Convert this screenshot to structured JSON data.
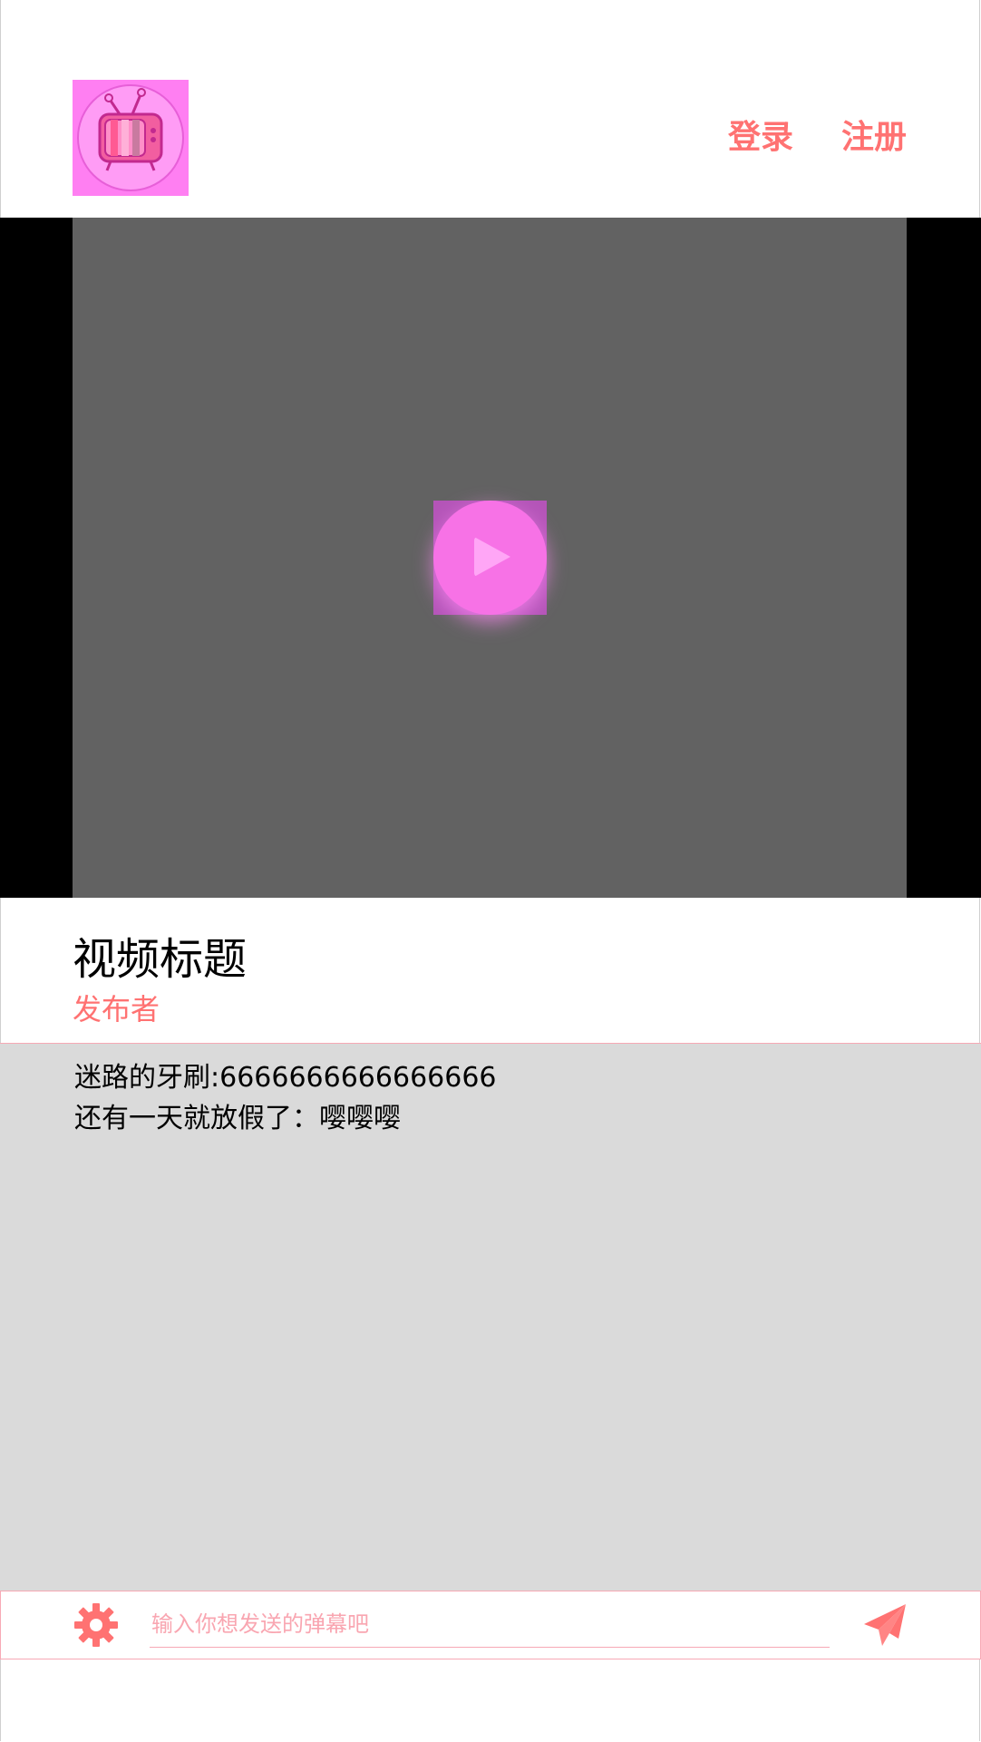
{
  "header": {
    "login_label": "登录",
    "register_label": "注册",
    "accent_color": "#ff7272",
    "logo_bg_color": "#ff7ff2"
  },
  "player": {
    "play_icon": "play-icon",
    "play_color": "#f772e6"
  },
  "video": {
    "title": "视频标题",
    "publisher": "发布者",
    "title_color": "#000000",
    "publisher_color": "#ff7272"
  },
  "comments": [
    "迷路的牙刷:6666666666666666",
    "还有一天就放假了：嘤嘤嘤"
  ],
  "bottom_bar": {
    "settings_icon": "gear-icon",
    "input_placeholder": "输入你想发送的弹幕吧",
    "send_icon": "paper-plane-icon"
  }
}
